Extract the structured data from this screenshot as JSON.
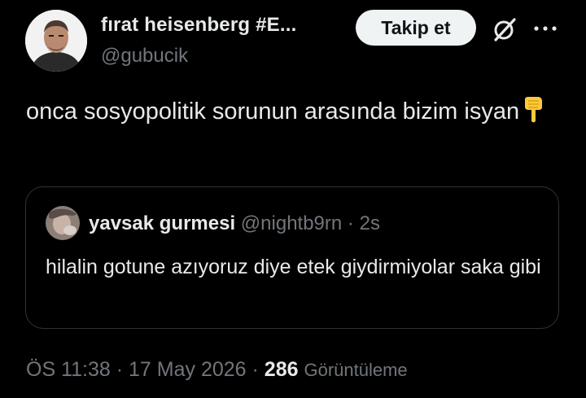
{
  "author": {
    "display_name": "fırat heisenberg #E...",
    "handle": "@gubucik",
    "avatar_icon": "profile-photo"
  },
  "actions": {
    "follow_label": "Takip et",
    "grok_icon": "grok-icon",
    "more_icon": "more-horizontal-icon"
  },
  "tweet": {
    "text": "onca sosyopolitik sorunun arasında bizim isyan",
    "emoji": "backhand-index-pointing-down"
  },
  "quote": {
    "display_name": "yavsak gurmesi",
    "handle": "@nightb9rn",
    "separator": "·",
    "time": "2s",
    "text": "hilalin gotune azıyoruz diye etek giydirmiyolar saka gibi"
  },
  "meta": {
    "time": "ÖS 11:38",
    "separator": "·",
    "date": "17 May 2026",
    "views_count": "286",
    "views_label": "Görüntüleme"
  },
  "colors": {
    "background": "#000000",
    "primary_text": "#e7e9ea",
    "secondary_text": "#71767b",
    "border": "#2f3336",
    "follow_button_bg": "#eff3f4"
  }
}
